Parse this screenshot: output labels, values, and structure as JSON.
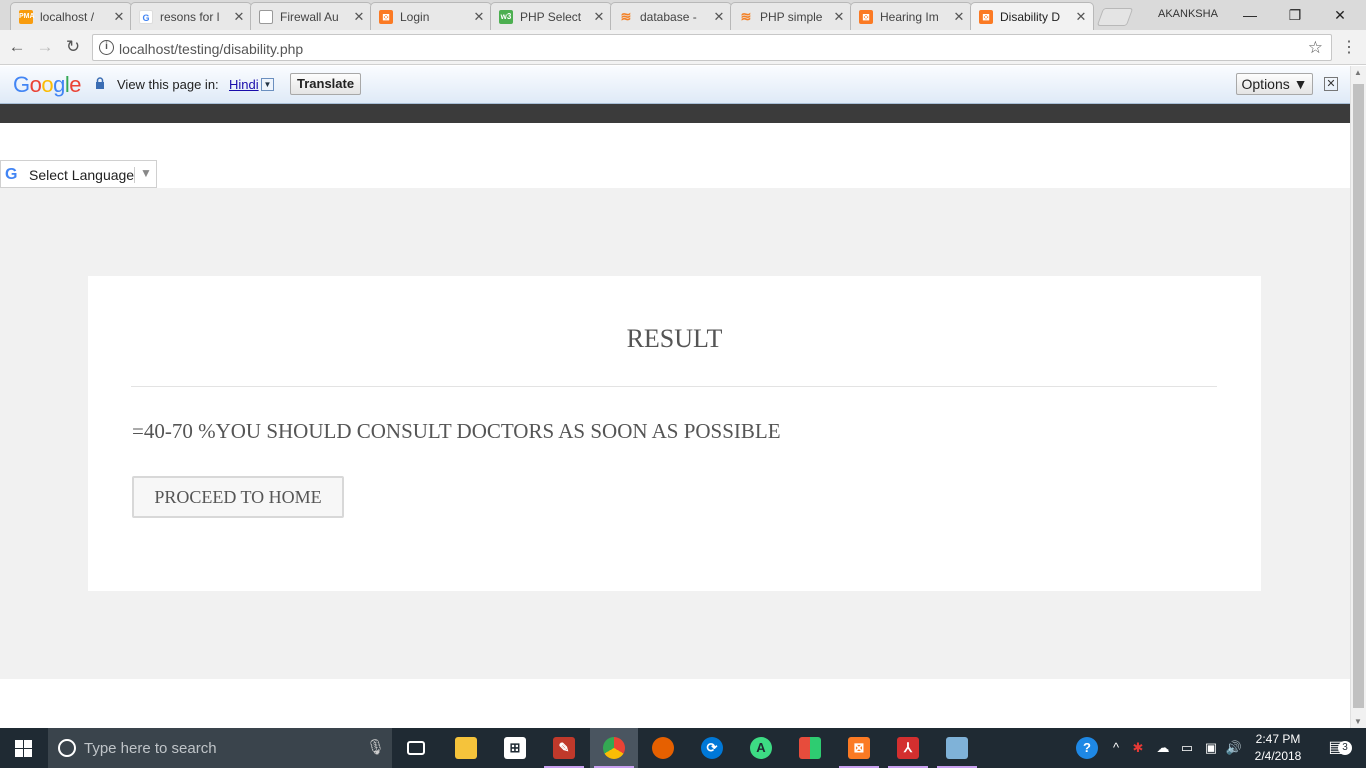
{
  "browser": {
    "tabs": [
      {
        "label": "localhost /",
        "icon": "pma-icon",
        "color": "#f89c0e"
      },
      {
        "label": "resons for l",
        "icon": "google-icon",
        "color": "#4285f4"
      },
      {
        "label": "Firewall Au",
        "icon": "page-icon",
        "color": "#9e9e9e"
      },
      {
        "label": "Login",
        "icon": "xampp-icon",
        "color": "#fb7a24"
      },
      {
        "label": "PHP Select",
        "icon": "w3-icon",
        "color": "#4caf50"
      },
      {
        "label": "database -",
        "icon": "stackoverflow-icon",
        "color": "#f48024"
      },
      {
        "label": "PHP simple",
        "icon": "stackoverflow-icon",
        "color": "#f48024"
      },
      {
        "label": "Hearing Im",
        "icon": "xampp-icon",
        "color": "#fb7a24"
      },
      {
        "label": "Disability D",
        "icon": "xampp-icon",
        "color": "#fb7a24"
      }
    ],
    "user": "AKANKSHA",
    "url": "localhost/testing/disability.php"
  },
  "translate_bar": {
    "view_text": "View this page in:",
    "language": "Hindi",
    "translate_label": "Translate",
    "options_label": "Options ▼"
  },
  "page": {
    "select_language": "Select Language",
    "result_title": "RESULT",
    "result_message": "=40-70 %YOU SHOULD CONSULT DOCTORS AS SOON AS POSSIBLE",
    "proceed_label": "PROCEED TO HOME"
  },
  "taskbar": {
    "search_placeholder": "Type here to search",
    "time": "2:47 PM",
    "date": "2/4/2018",
    "notification_count": "3"
  }
}
